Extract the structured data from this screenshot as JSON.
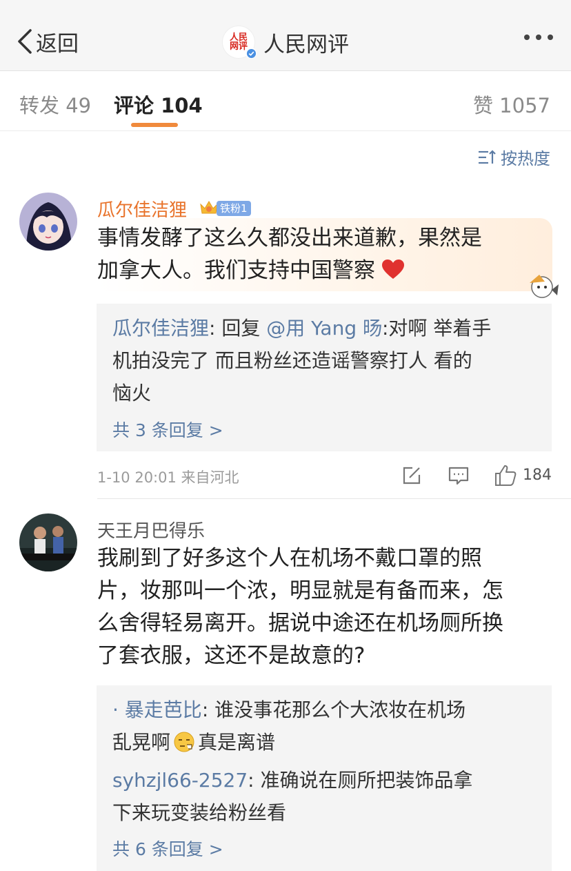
{
  "nav": {
    "back_label": "返回",
    "title": "人民网评",
    "logo_text_top": "人民",
    "logo_text_bottom": "网评"
  },
  "tabs": {
    "repost": "转发 49",
    "comment": "评论 104",
    "like": "赞 1057"
  },
  "sort_label": "按热度",
  "comments": [
    {
      "username": "瓜尔佳洁狸",
      "fan_badge": "铁粉1",
      "text_lines": [
        "事情发酵了这么久都没出来道歉，果然是",
        "加拿大人。我们支持中国警察"
      ],
      "replies": [
        {
          "user": "瓜尔佳洁狸",
          "prefix": ": 回复 ",
          "mention": "@用 Yang 旸",
          "text_lines": [
            ":对啊 举着手",
            "机拍没完了 而且粉丝还造谣警察打人 看的",
            "恼火"
          ]
        }
      ],
      "more_replies": "共 3 条回复 >",
      "time": "1-10 20:01",
      "source": "来自河北",
      "likes": "184"
    },
    {
      "username": "天王月巴得乐",
      "text_lines": [
        "我刷到了好多这个人在机场不戴口罩的照",
        "片，妆那叫一个浓，明显就是有备而来，怎",
        "么舍得轻易离开。据说中途还在机场厕所换",
        "了套衣服，这还不是故意的?"
      ],
      "replies": [
        {
          "user": "· 暴走芭比",
          "sep": ": ",
          "text_lines": [
            "谁没事花那么个大浓妆在机场",
            "乱晃啊",
            "真是离谱"
          ]
        },
        {
          "user": "syhzjl66-2527",
          "sep": ": ",
          "text_lines": [
            "准确说在厕所把装饰品拿",
            "下来玩变装给粉丝看"
          ]
        }
      ],
      "more_replies": "共 6 条回复 >"
    }
  ],
  "colors": {
    "link_blue": "#5b7ba4",
    "accent_orange": "#f08a3c",
    "username_orange": "#e8732b",
    "heart_red": "#e0322f"
  },
  "icons": [
    "back-chevron-icon",
    "verified-icon",
    "more-icon",
    "sort-icon",
    "crown-icon",
    "heart-icon",
    "share-icon",
    "comment-icon",
    "thumbs-up-icon",
    "smirk-emoji-icon"
  ]
}
